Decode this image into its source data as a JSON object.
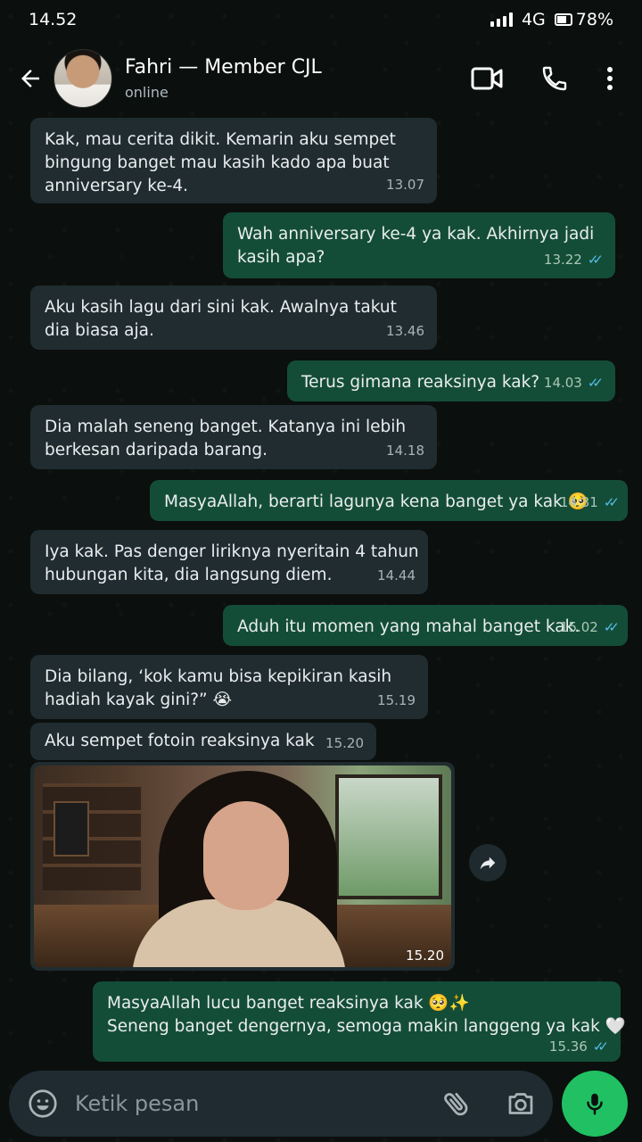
{
  "status_bar": {
    "time": "14.52",
    "network": "4G",
    "battery": "78%"
  },
  "header": {
    "contact_name": "Fahri — Member CJL",
    "contact_status": "online"
  },
  "messages": [
    {
      "dir": "in",
      "lines": [
        "Kak, mau cerita dikit. Kemarin aku sempet",
        "bingung banget mau kasih kado apa buat",
        "anniversary ke-4."
      ],
      "time": "13.07"
    },
    {
      "dir": "out",
      "lines": [
        "Wah anniversary ke-4 ya kak. Akhirnya jadi",
        "kasih apa?"
      ],
      "time": "13.22",
      "read": true
    },
    {
      "dir": "in",
      "lines": [
        "Aku kasih lagu dari sini kak. Awalnya takut",
        "dia biasa aja."
      ],
      "time": "13.46"
    },
    {
      "dir": "out",
      "lines": [
        "Terus gimana reaksinya kak?"
      ],
      "time": "14.03",
      "read": true
    },
    {
      "dir": "in",
      "lines": [
        "Dia malah seneng banget. Katanya ini lebih",
        "berkesan daripada barang."
      ],
      "time": "14.18"
    },
    {
      "dir": "out",
      "lines": [
        "MasyaAllah, berarti lagunya kena banget ya kak 🥺"
      ],
      "time": "14.31",
      "read": true
    },
    {
      "dir": "in",
      "lines": [
        "Iya kak. Pas denger liriknya nyeritain 4 tahun",
        "hubungan kita, dia langsung diem."
      ],
      "time": "14.44"
    },
    {
      "dir": "out",
      "lines": [
        "Aduh itu momen yang mahal banget kak."
      ],
      "time": "15.02",
      "read": true
    },
    {
      "dir": "in",
      "lines": [
        "Dia bilang, ‘kok kamu bisa kepikiran kasih",
        "hadiah kayak gini?” 😭"
      ],
      "time": "15.19"
    },
    {
      "dir": "in",
      "lines": [
        "Aku sempet fotoin reaksinya kak"
      ],
      "time": "15.20"
    },
    {
      "dir": "out",
      "lines": [
        "MasyaAllah lucu banget reaksinya kak 🥺✨",
        "Seneng banget dengernya, semoga makin langgeng ya kak 🤍"
      ],
      "time": "15.36",
      "read": true
    }
  ],
  "photo": {
    "time": "15.20"
  },
  "input": {
    "placeholder": "Ketik pesan"
  },
  "colors": {
    "incoming_bubble": "#202c2f",
    "outgoing_bubble": "#144d37",
    "read_ticks": "#53bdeb",
    "mic_button": "#21c063"
  },
  "icons": [
    "back-arrow-icon",
    "video-call-icon",
    "phone-icon",
    "more-options-icon",
    "forward-icon",
    "emoji-icon",
    "attach-icon",
    "camera-icon",
    "mic-icon"
  ]
}
